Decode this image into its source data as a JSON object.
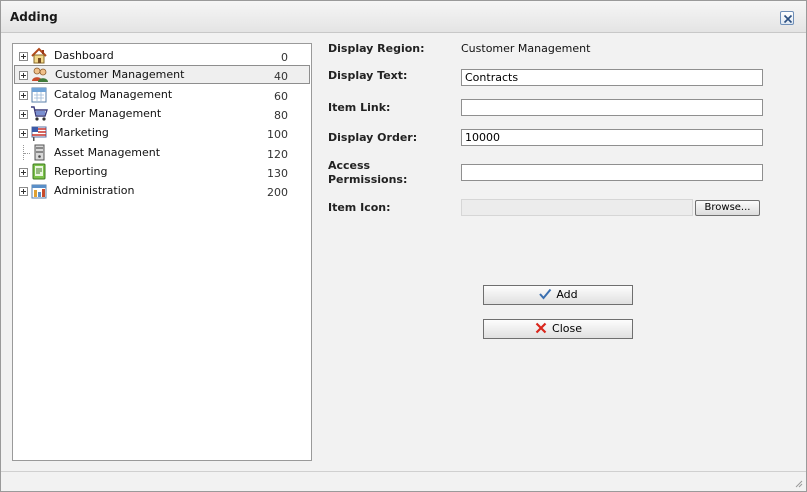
{
  "dialog": {
    "title": "Adding",
    "close_icon": "close-x-icon"
  },
  "tree": {
    "nodes": [
      {
        "label": "Dashboard",
        "order": "0",
        "icon": "home-icon",
        "expandable": true,
        "selected": false
      },
      {
        "label": "Customer Management",
        "order": "40",
        "icon": "users-icon",
        "expandable": true,
        "selected": true
      },
      {
        "label": "Catalog Management",
        "order": "60",
        "icon": "calendar-icon",
        "expandable": true,
        "selected": false
      },
      {
        "label": "Order Management",
        "order": "80",
        "icon": "cart-icon",
        "expandable": true,
        "selected": false
      },
      {
        "label": "Marketing",
        "order": "100",
        "icon": "flag-icon",
        "expandable": true,
        "selected": false
      },
      {
        "label": "Asset Management",
        "order": "120",
        "icon": "server-icon",
        "expandable": false,
        "selected": false
      },
      {
        "label": "Reporting",
        "order": "130",
        "icon": "report-icon",
        "expandable": true,
        "selected": false
      },
      {
        "label": "Administration",
        "order": "200",
        "icon": "admin-icon",
        "expandable": true,
        "selected": false
      }
    ]
  },
  "form": {
    "display_region_label": "Display Region:",
    "display_region_value": "Customer Management",
    "display_text_label": "Display Text:",
    "display_text_value": "Contracts",
    "item_link_label": "Item Link:",
    "item_link_value": "",
    "display_order_label": "Display Order:",
    "display_order_value": "10000",
    "access_permissions_label_1": "Access",
    "access_permissions_label_2": "Permissions:",
    "access_permissions_value": "",
    "item_icon_label": "Item Icon:",
    "browse_label": "Browse..."
  },
  "actions": {
    "add_label": "Add",
    "close_label": "Close",
    "add_icon": "checkmark-icon",
    "close_icon": "red-x-icon"
  },
  "colors": {
    "checkmark": "#3a6fb0",
    "close_x": "#d9261c"
  }
}
